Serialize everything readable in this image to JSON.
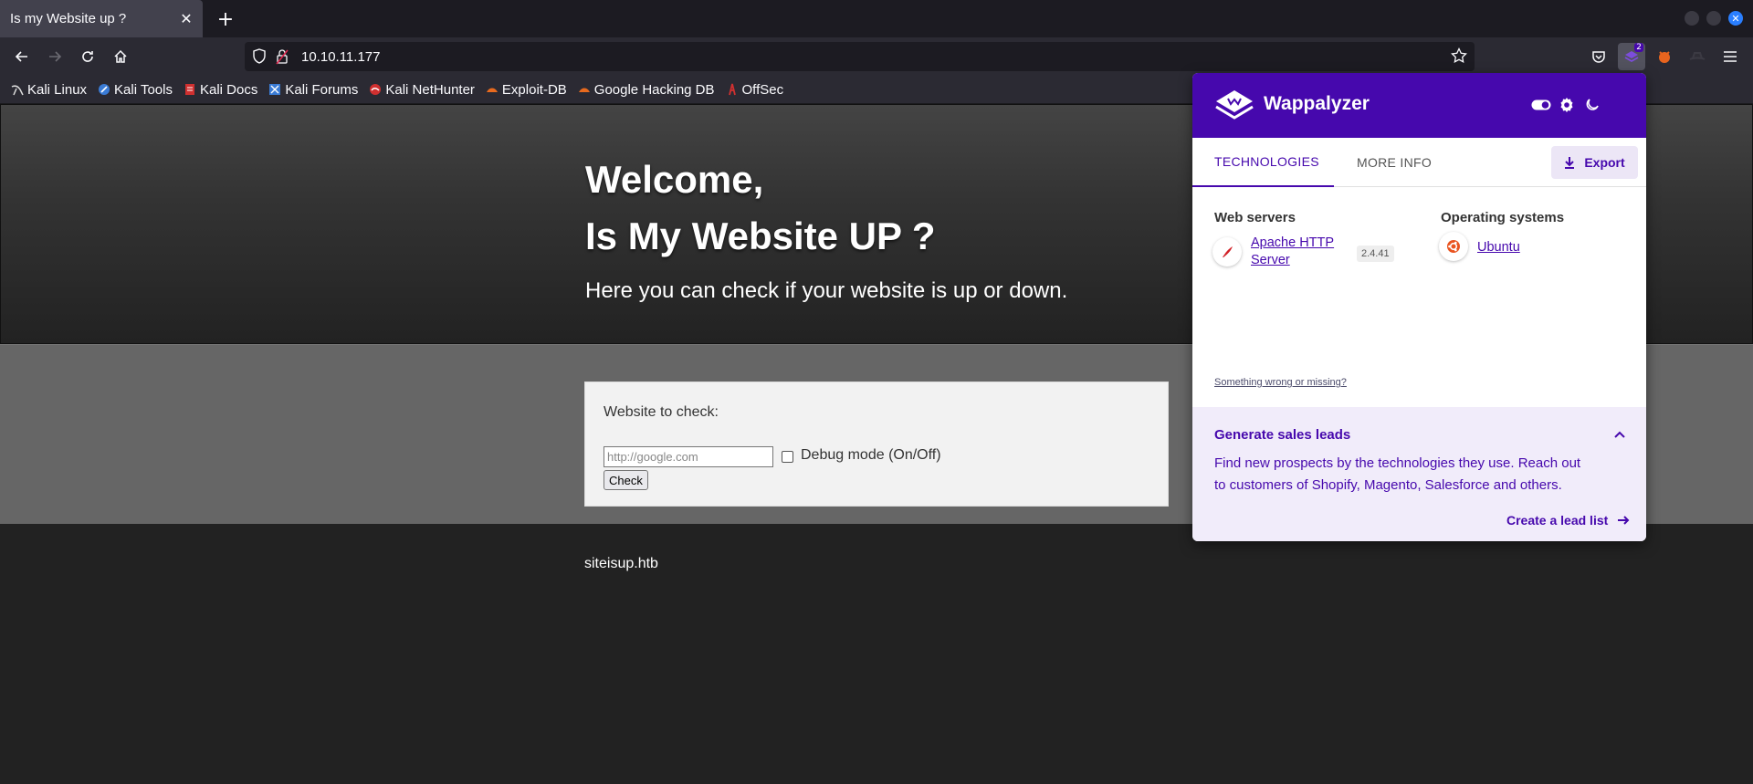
{
  "browser": {
    "tab_title": "Is my Website up ?",
    "tab_close_icon": "close-icon",
    "new_tab_label": "+",
    "url": "10.10.11.177"
  },
  "bookmarks": [
    {
      "label": "Kali Linux",
      "icon": "kali-linux-icon",
      "color": "#ffffff"
    },
    {
      "label": "Kali Tools",
      "icon": "kali-tools-icon",
      "color": "#3a7bd5"
    },
    {
      "label": "Kali Docs",
      "icon": "kali-docs-icon",
      "color": "#d03030"
    },
    {
      "label": "Kali Forums",
      "icon": "kali-forums-icon",
      "color": "#3a7bd5"
    },
    {
      "label": "Kali NetHunter",
      "icon": "kali-nethunter-icon",
      "color": "#d03030"
    },
    {
      "label": "Exploit-DB",
      "icon": "exploit-db-icon",
      "color": "#e86a1e"
    },
    {
      "label": "Google Hacking DB",
      "icon": "ghdb-icon",
      "color": "#e86a1e"
    },
    {
      "label": "OffSec",
      "icon": "offsec-icon",
      "color": "#d03030"
    }
  ],
  "site": {
    "heading1": "Welcome,",
    "heading2": "Is My Website UP ?",
    "subheading": "Here you can check if your website is up or down.",
    "form_label": "Website to check:",
    "input_placeholder": "http://google.com",
    "debug_label": "Debug mode (On/Off)",
    "check_button": "Check",
    "footer": "siteisup.htb"
  },
  "wappalyzer": {
    "brand": "Wappalyzer",
    "tabs": [
      "TECHNOLOGIES",
      "MORE INFO"
    ],
    "export_label": "Export",
    "categories": [
      {
        "name": "Web servers",
        "tech_line1": "Apache HTTP",
        "tech_line2": "Server",
        "version": "2.4.41",
        "icon": "apache-feather-icon"
      },
      {
        "name": "Operating systems",
        "tech": "Ubuntu",
        "icon": "ubuntu-icon"
      }
    ],
    "wrong_link": "Something wrong or missing?",
    "leads_title": "Generate sales leads",
    "leads_text": "Find new prospects by the technologies they use. Reach out to customers of Shopify, Magento, Salesforce and others.",
    "leads_cta": "Create a lead list",
    "accent": "#4608ad",
    "badge_count": "2"
  }
}
